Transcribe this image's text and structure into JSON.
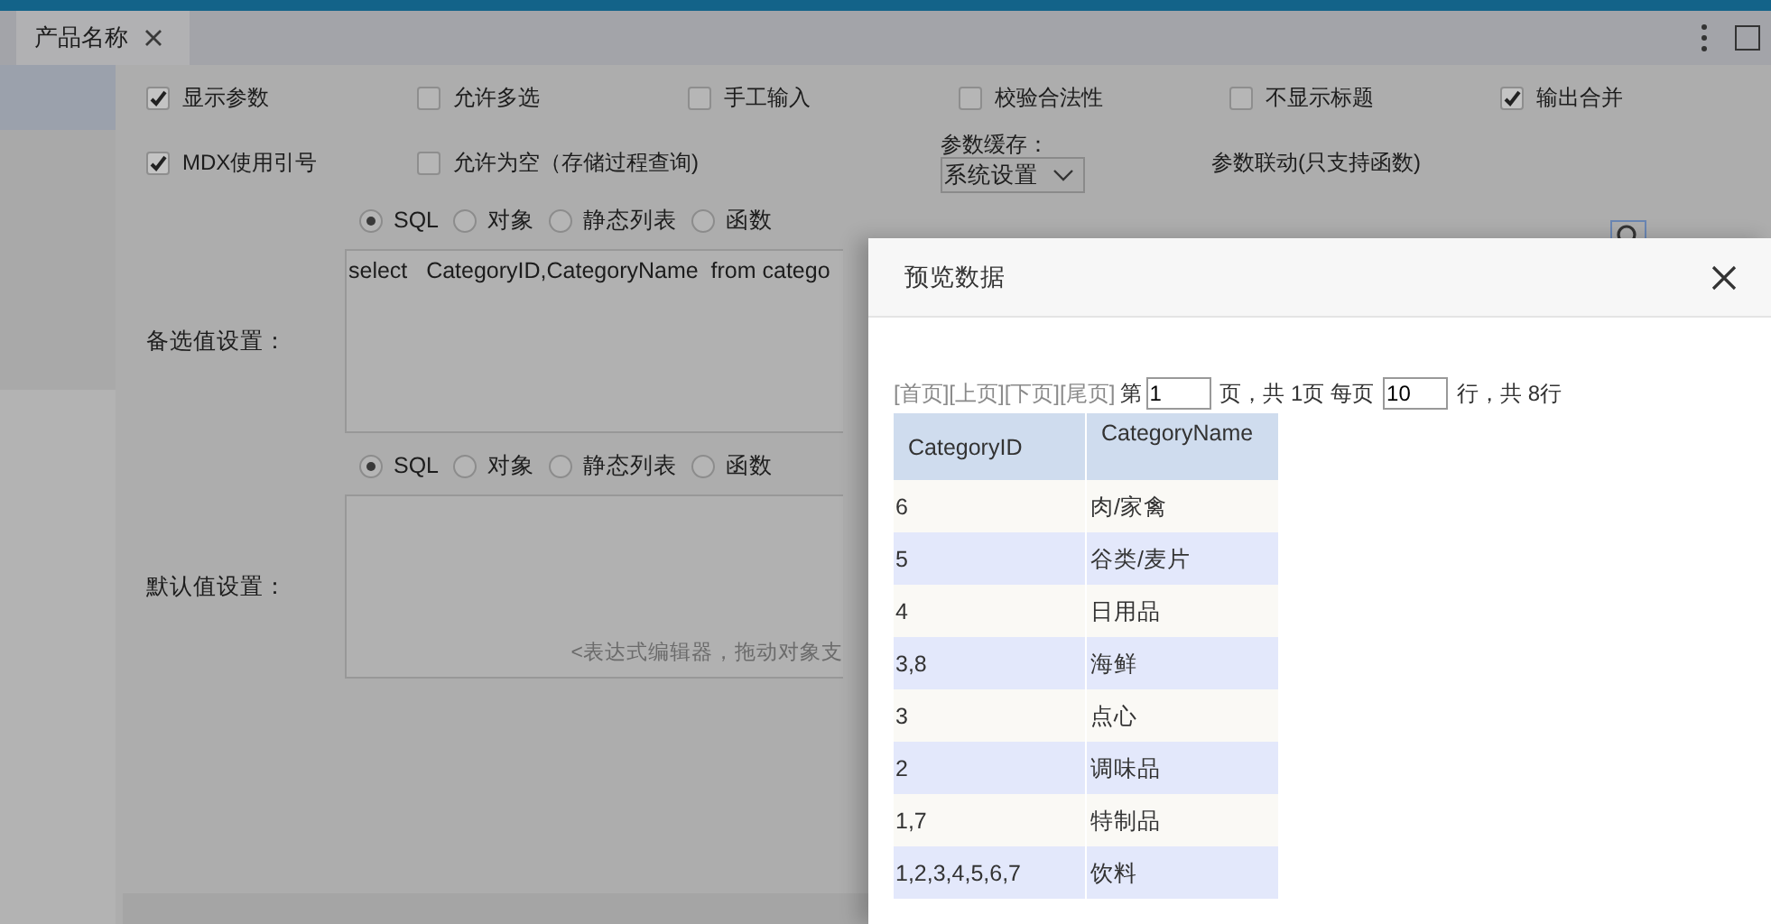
{
  "tab": {
    "label": "产品名称",
    "selected": true
  },
  "options_row1": [
    {
      "label": "显示参数",
      "checked": true
    },
    {
      "label": "允许多选",
      "checked": false
    },
    {
      "label": "手工输入",
      "checked": false
    },
    {
      "label": "校验合法性",
      "checked": false
    },
    {
      "label": "不显示标题",
      "checked": false
    },
    {
      "label": "输出合并",
      "checked": true
    }
  ],
  "options_row2": [
    {
      "kind": "checkbox",
      "label": "MDX使用引号",
      "checked": true
    },
    {
      "kind": "checkbox",
      "label": "允许为空（存储过程查询)",
      "checked": false
    },
    {
      "kind": "select",
      "label": "参数缓存：",
      "value": "系统设置"
    },
    {
      "kind": "text",
      "label": "参数联动(只支持函数)"
    }
  ],
  "candidate": {
    "label": "备选值设置：",
    "sources": [
      {
        "label": "SQL",
        "selected": true
      },
      {
        "label": "对象",
        "selected": false
      },
      {
        "label": "静态列表",
        "selected": false
      },
      {
        "label": "函数",
        "selected": false
      }
    ],
    "value": "select   CategoryID,CategoryName  from catego"
  },
  "default": {
    "label": "默认值设置：",
    "sources": [
      {
        "label": "SQL",
        "selected": true
      },
      {
        "label": "对象",
        "selected": false
      },
      {
        "label": "静态列表",
        "selected": false
      },
      {
        "label": "函数",
        "selected": false
      }
    ],
    "placeholder": "<表达式编辑器，拖动对象支"
  },
  "dialog": {
    "title": "预览数据",
    "pager": {
      "links": [
        "[首页]",
        "[上页]",
        "[下页]",
        "[尾页]"
      ],
      "page_prefix": "第",
      "page": "1",
      "page_suffix": "页，共 1页 每页",
      "page_size": "10",
      "rows_suffix": "行，共 8行"
    },
    "table": {
      "columns": [
        "CategoryID",
        "CategoryName"
      ],
      "rows": [
        [
          "6",
          "肉/家禽"
        ],
        [
          "5",
          "谷类/麦片"
        ],
        [
          "4",
          "日用品"
        ],
        [
          "3,8",
          "海鲜"
        ],
        [
          "3",
          "点心"
        ],
        [
          "2",
          "调味品"
        ],
        [
          "1,7",
          "特制品"
        ],
        [
          "1,2,3,4,5,6,7",
          "饮料"
        ]
      ]
    }
  }
}
